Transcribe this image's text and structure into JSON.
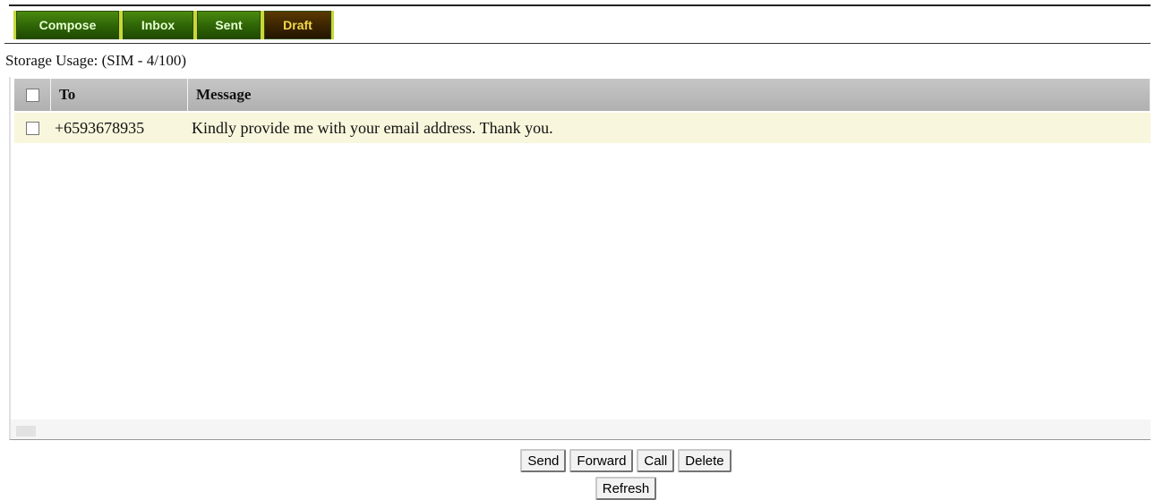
{
  "tabs": {
    "compose": "Compose",
    "inbox": "Inbox",
    "sent": "Sent",
    "draft": "Draft",
    "active": "Draft"
  },
  "storage": {
    "text": "Storage Usage: (SIM - 4/100)"
  },
  "table": {
    "headers": {
      "to": "To",
      "message": "Message"
    },
    "rows": [
      {
        "to": "+6593678935",
        "message": "Kindly provide me with your email address. Thank you."
      }
    ]
  },
  "actions": {
    "send": "Send",
    "forward": "Forward",
    "call": "Call",
    "delete": "Delete",
    "refresh": "Refresh"
  },
  "colors": {
    "tab_green": "#2e6306",
    "tab_active": "#3a2300",
    "header_gray": "#b8b8b8",
    "row_highlight": "#f8f6dc"
  }
}
